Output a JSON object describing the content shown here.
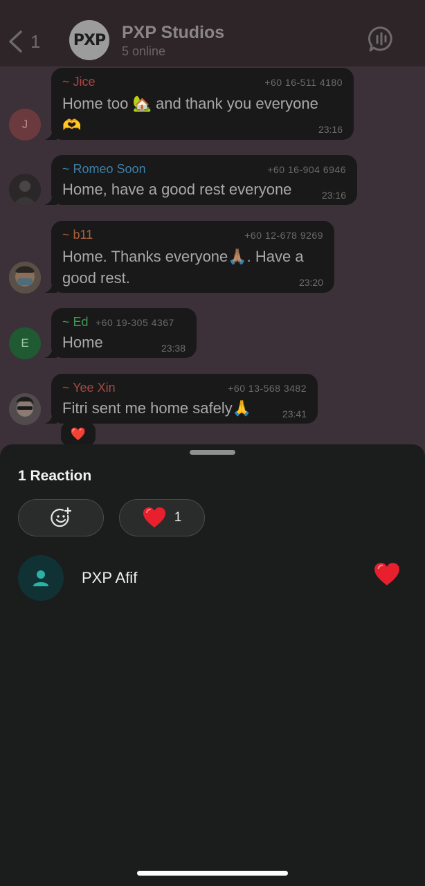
{
  "header": {
    "back_count": "1",
    "group_avatar_text": "PXP",
    "title": "PXP Studios",
    "subtitle": "5 online"
  },
  "messages": [
    {
      "sender": "~ Jice",
      "phone": "+60 16-511 4180",
      "text_line1": "Home too 🏡 and thank you everyone",
      "text_line2": "🫶",
      "time": "23:16",
      "avatar_letter": "J",
      "sender_color": "#b5443f"
    },
    {
      "sender": "~ Romeo Soon",
      "phone": "+60 16-904 6946",
      "text_line1": "Home, have a good rest everyone",
      "time": "23:16",
      "sender_color": "#3f7fa6"
    },
    {
      "sender": "~ b11",
      "phone": "+60 12-678 9269",
      "text_line1": "Home. Thanks everyone🙏🏽. Have a",
      "text_line2": "good rest.",
      "time": "23:20",
      "sender_color": "#a8603a"
    },
    {
      "sender": "~ Ed",
      "phone": "+60 19-305 4367",
      "text_line1": "Home",
      "time": "23:38",
      "avatar_letter": "E",
      "sender_color": "#3e9a52"
    },
    {
      "sender": "~ Yee Xin",
      "phone": "+60 13-568 3482",
      "text_line1": "Fitri sent me home safely🙏",
      "time": "23:41",
      "sender_color": "#a54a45",
      "reaction": "❤️"
    }
  ],
  "sheet": {
    "title": "1 Reaction",
    "add_reaction_icon": "emoji-add-icon",
    "heart_emoji": "❤️",
    "heart_count": "1",
    "reactor_name": "PXP Afif",
    "reactor_emoji": "❤️"
  },
  "colors": {
    "chat_bg": "#3d3139",
    "bubble_bg": "#191919",
    "sheet_bg": "#1b1c1c",
    "accent_teal": "#2ab3a4"
  }
}
